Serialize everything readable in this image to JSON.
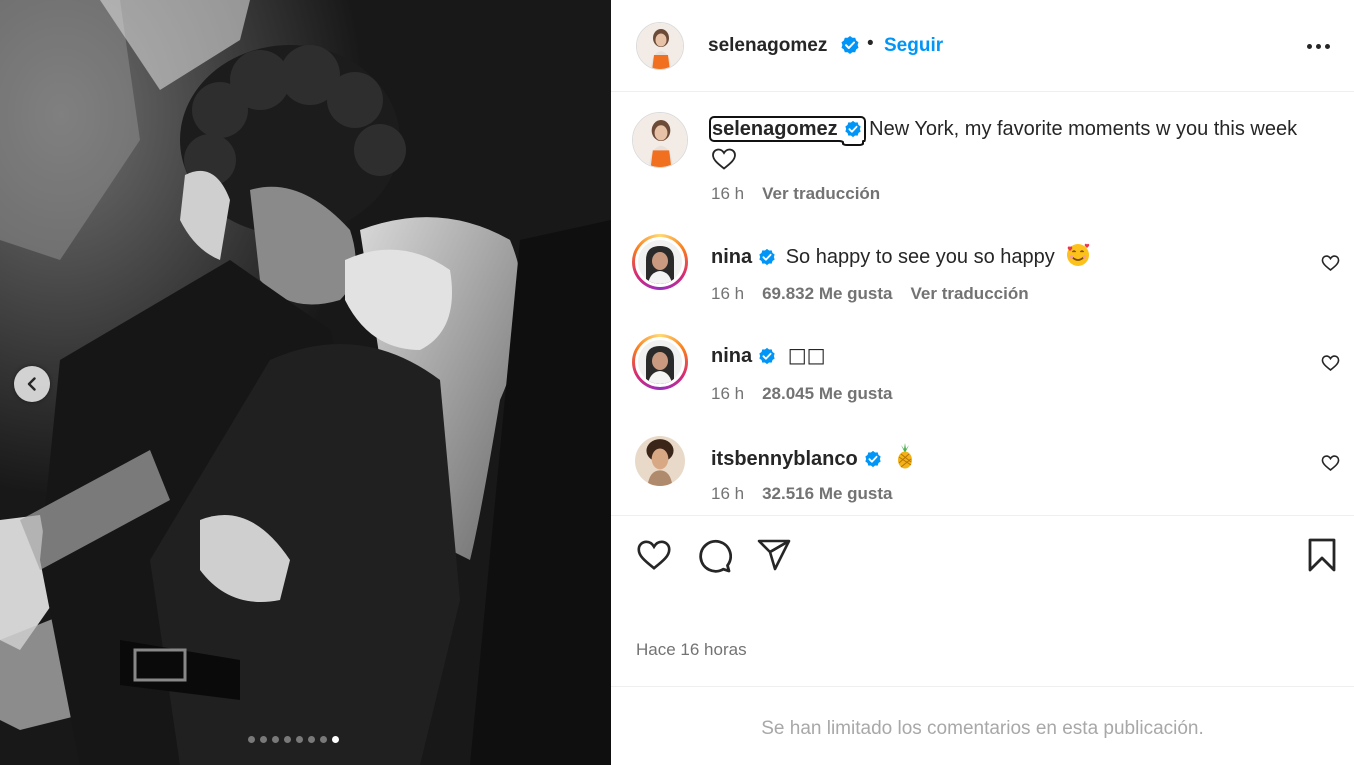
{
  "post": {
    "author": "selenagomez",
    "follow_label": "Seguir",
    "separator": "•",
    "carousel": {
      "total_slides": 8,
      "active_slide": 8
    }
  },
  "caption": {
    "username": "selenagomez",
    "text": "New York, my favorite moments w you this week",
    "time": "16 h",
    "translate": "Ver traducción"
  },
  "comments": [
    {
      "username": "nina",
      "text": "So happy to see you so happy",
      "time": "16 h",
      "likes": "69.832 Me gusta",
      "translate": "Ver traducción"
    },
    {
      "username": "nina",
      "text": "□□",
      "time": "16 h",
      "likes": "28.045 Me gusta"
    },
    {
      "username": "itsbennyblanco",
      "text": "",
      "time": "16 h",
      "likes": "32.516 Me gusta"
    }
  ],
  "footer": {
    "timestamp": "Hace 16 horas",
    "comments_limited": "Se han limitado los comentarios en esta publicación."
  },
  "icons": {
    "verified": "verified-badge-icon",
    "like": "heart-icon",
    "comment": "comment-bubble-icon",
    "share": "paper-plane-icon",
    "save": "bookmark-icon",
    "more": "more-options-icon",
    "prev": "chevron-left-icon"
  },
  "colors": {
    "accent": "#0095f6",
    "verified": "#0095f6",
    "text": "#262626",
    "muted": "#737373"
  }
}
